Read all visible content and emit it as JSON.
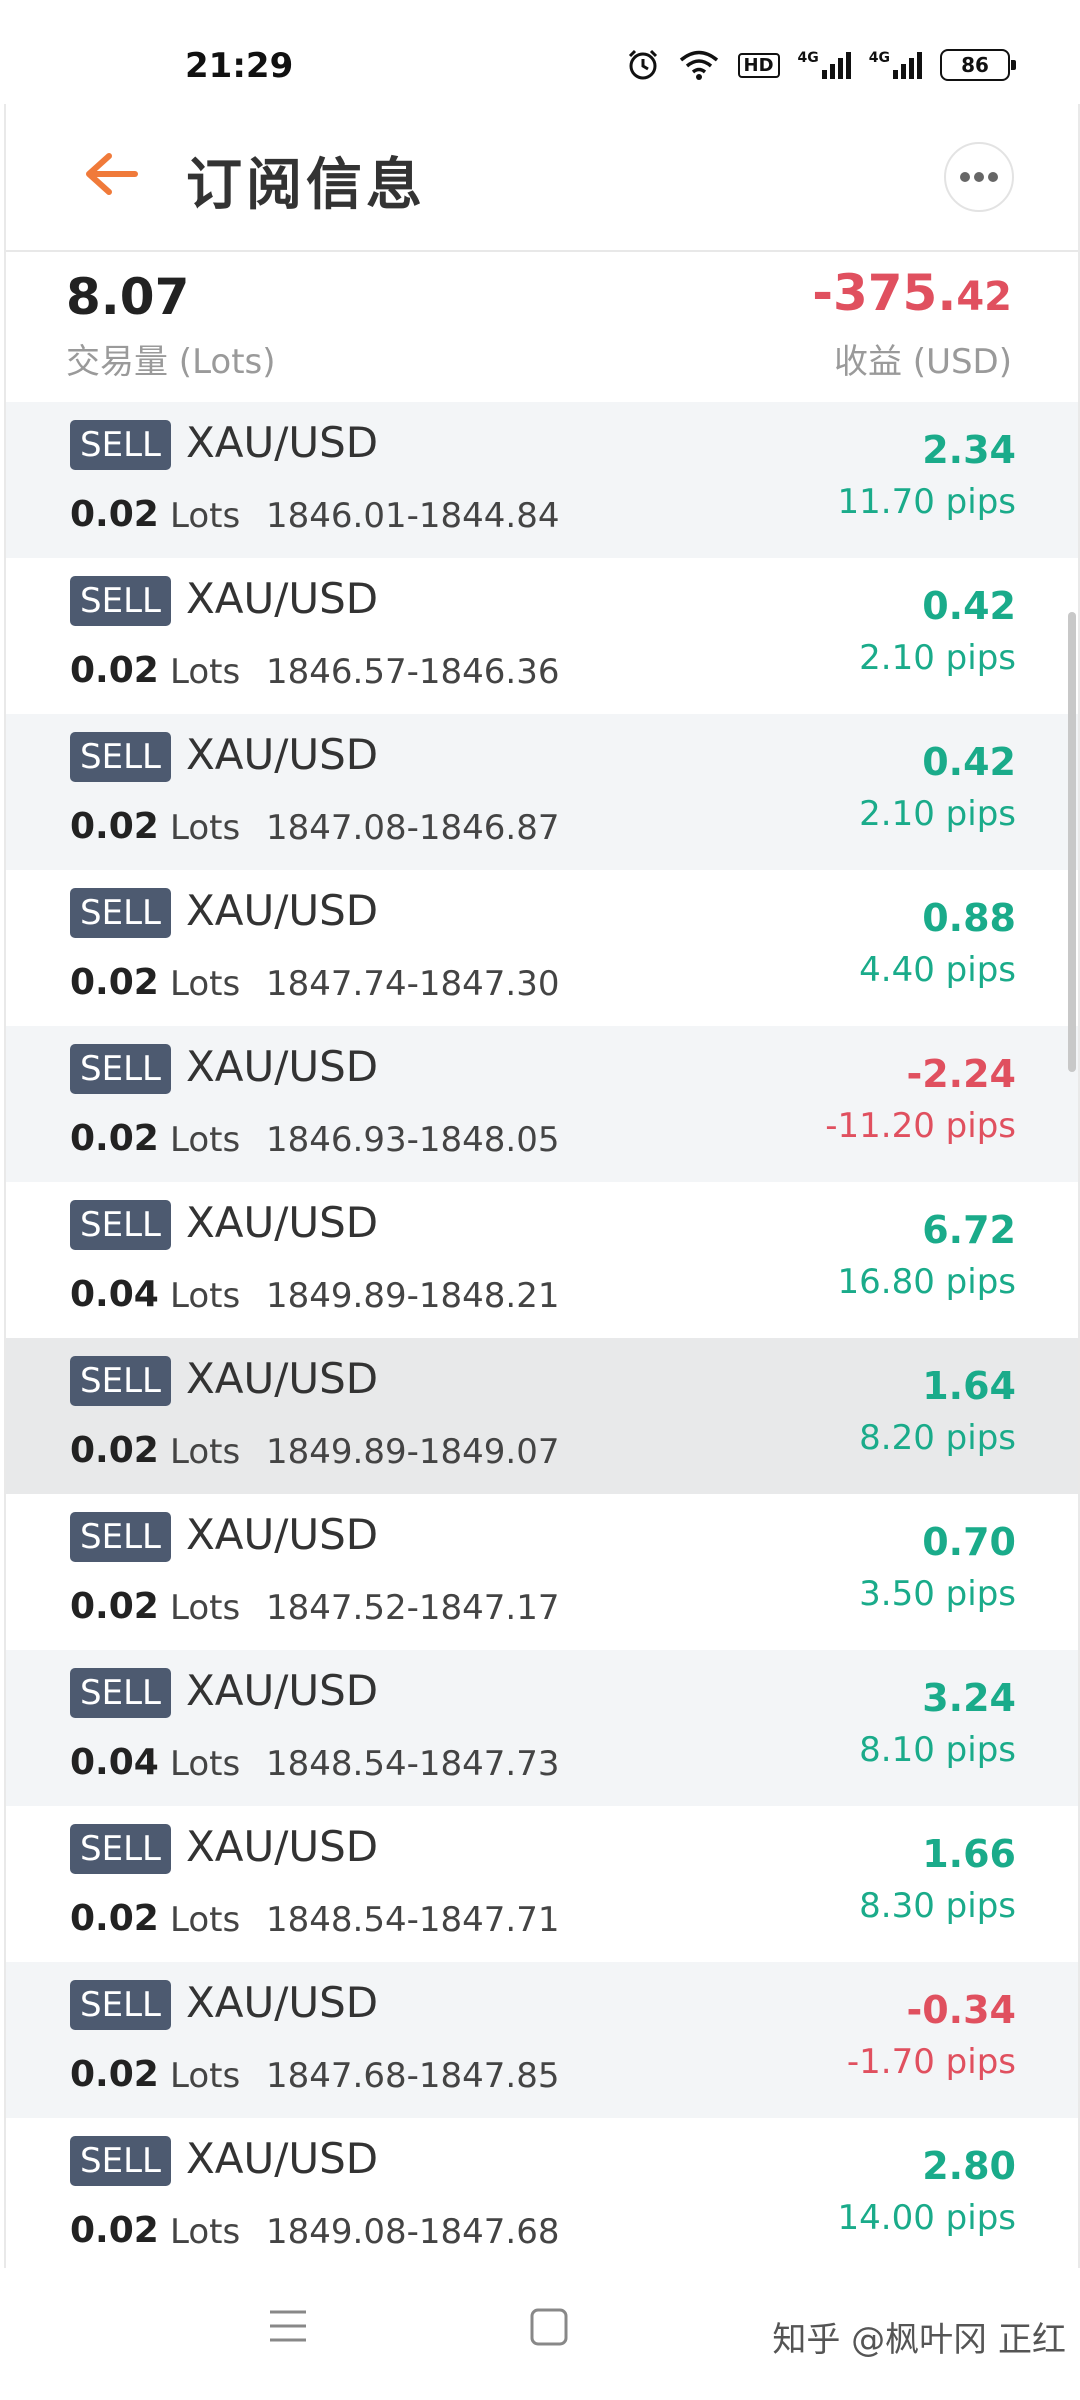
{
  "status_bar": {
    "time": "21:29",
    "network_1": "4G",
    "network_2": "4G",
    "hd_label": "HD",
    "battery": "86"
  },
  "header": {
    "title": "订阅信息"
  },
  "summary": {
    "lots_value": "8.07",
    "lots_label": "交易量 (Lots)",
    "profit_int": "-375.",
    "profit_dec": "42",
    "profit_label": "收益 (USD)"
  },
  "colors": {
    "positive": "#1aab8a",
    "negative": "#e0505f",
    "badge": "#4d5a70",
    "accent_back": "#f07a3a"
  },
  "trades": [
    {
      "side": "SELL",
      "symbol": "XAU/USD",
      "lots": "0.02",
      "unit": "Lots",
      "range": "1846.01-1844.84",
      "profit": "2.34",
      "pips": "11.70 pips",
      "negative": false
    },
    {
      "side": "SELL",
      "symbol": "XAU/USD",
      "lots": "0.02",
      "unit": "Lots",
      "range": "1846.57-1846.36",
      "profit": "0.42",
      "pips": "2.10 pips",
      "negative": false
    },
    {
      "side": "SELL",
      "symbol": "XAU/USD",
      "lots": "0.02",
      "unit": "Lots",
      "range": "1847.08-1846.87",
      "profit": "0.42",
      "pips": "2.10 pips",
      "negative": false
    },
    {
      "side": "SELL",
      "symbol": "XAU/USD",
      "lots": "0.02",
      "unit": "Lots",
      "range": "1847.74-1847.30",
      "profit": "0.88",
      "pips": "4.40 pips",
      "negative": false
    },
    {
      "side": "SELL",
      "symbol": "XAU/USD",
      "lots": "0.02",
      "unit": "Lots",
      "range": "1846.93-1848.05",
      "profit": "-2.24",
      "pips": "-11.20 pips",
      "negative": true
    },
    {
      "side": "SELL",
      "symbol": "XAU/USD",
      "lots": "0.04",
      "unit": "Lots",
      "range": "1849.89-1848.21",
      "profit": "6.72",
      "pips": "16.80 pips",
      "negative": false
    },
    {
      "side": "SELL",
      "symbol": "XAU/USD",
      "lots": "0.02",
      "unit": "Lots",
      "range": "1849.89-1849.07",
      "profit": "1.64",
      "pips": "8.20 pips",
      "negative": false
    },
    {
      "side": "SELL",
      "symbol": "XAU/USD",
      "lots": "0.02",
      "unit": "Lots",
      "range": "1847.52-1847.17",
      "profit": "0.70",
      "pips": "3.50 pips",
      "negative": false
    },
    {
      "side": "SELL",
      "symbol": "XAU/USD",
      "lots": "0.04",
      "unit": "Lots",
      "range": "1848.54-1847.73",
      "profit": "3.24",
      "pips": "8.10 pips",
      "negative": false
    },
    {
      "side": "SELL",
      "symbol": "XAU/USD",
      "lots": "0.02",
      "unit": "Lots",
      "range": "1848.54-1847.71",
      "profit": "1.66",
      "pips": "8.30 pips",
      "negative": false
    },
    {
      "side": "SELL",
      "symbol": "XAU/USD",
      "lots": "0.02",
      "unit": "Lots",
      "range": "1847.68-1847.85",
      "profit": "-0.34",
      "pips": "-1.70 pips",
      "negative": true
    },
    {
      "side": "SELL",
      "symbol": "XAU/USD",
      "lots": "0.02",
      "unit": "Lots",
      "range": "1849.08-1847.68",
      "profit": "2.80",
      "pips": "14.00 pips",
      "negative": false
    }
  ],
  "nav": {
    "watermark": "知乎 @枫叶冈 正红"
  },
  "icons": {
    "back": "arrow-left-icon",
    "more": "more-horizontal-icon",
    "alarm": "alarm-icon",
    "wifi": "wifi-icon",
    "menu": "menu-icon",
    "home": "home-square-icon"
  }
}
